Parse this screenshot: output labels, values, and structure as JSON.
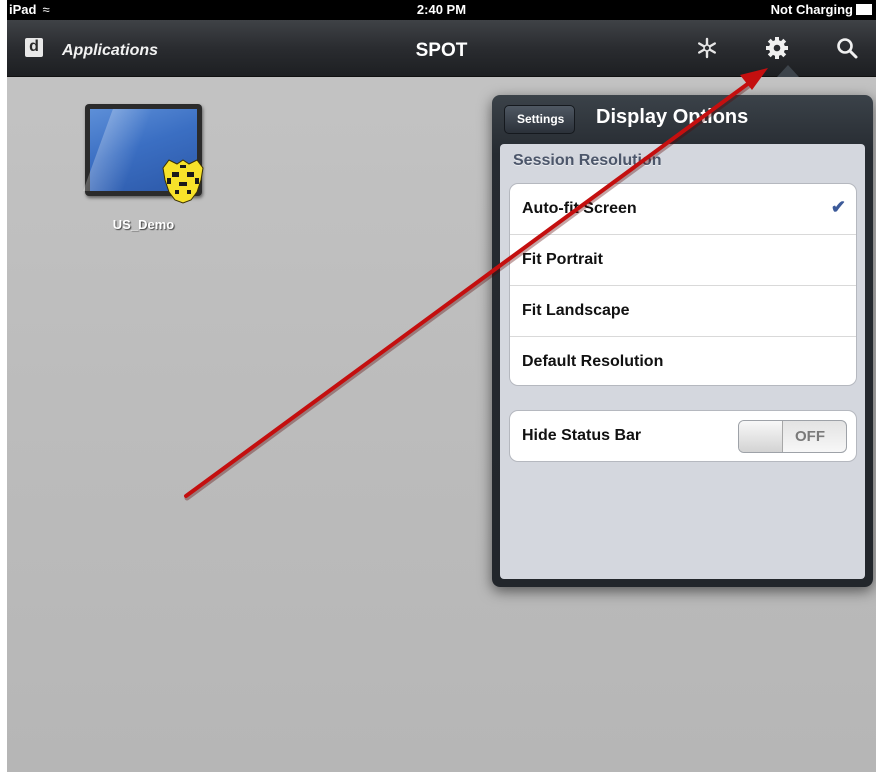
{
  "statusbar": {
    "device": "iPad",
    "time": "2:40 PM",
    "battery_text": "Not Charging"
  },
  "navbar": {
    "logo_letter": "d",
    "applications_label": "Applications",
    "title": "SPOT",
    "icons": [
      "snowflake-icon",
      "gear-icon",
      "search-icon"
    ]
  },
  "desktop": {
    "icon_label": "US_Demo"
  },
  "popover": {
    "back_label": "Settings",
    "title": "Display Options",
    "section_header": "Session Resolution",
    "resolution_options": [
      "Auto-fit Screen",
      "Fit Portrait",
      "Fit Landscape",
      "Default Resolution"
    ],
    "selected_option": "Auto-fit Screen",
    "hide_status_bar_label": "Hide Status Bar",
    "hide_status_bar_state": "OFF"
  },
  "colors": {
    "checkmark": "#3c5a99",
    "annotation_arrow": "#c40f0f",
    "navbar": "#2a2c30"
  }
}
